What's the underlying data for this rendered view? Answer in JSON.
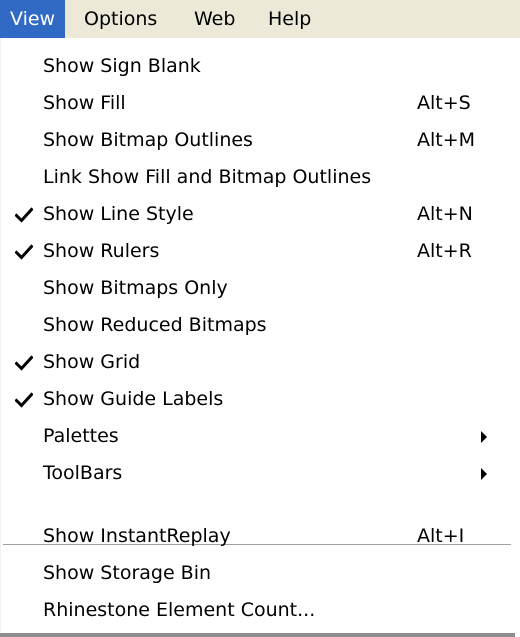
{
  "menubar": {
    "items": [
      {
        "label": "View",
        "active": true
      },
      {
        "label": "Options",
        "active": false
      },
      {
        "label": "Web",
        "active": false
      },
      {
        "label": "Help",
        "active": false
      }
    ]
  },
  "view_menu": {
    "items": [
      {
        "label": "Show Sign Blank",
        "shortcut": "",
        "checked": false,
        "submenu": false
      },
      {
        "label": "Show Fill",
        "shortcut": "Alt+S",
        "checked": false,
        "submenu": false
      },
      {
        "label": "Show Bitmap Outlines",
        "shortcut": "Alt+M",
        "checked": false,
        "submenu": false
      },
      {
        "label": "Link Show Fill and Bitmap Outlines",
        "shortcut": "",
        "checked": false,
        "submenu": false
      },
      {
        "label": "Show Line Style",
        "shortcut": "Alt+N",
        "checked": true,
        "submenu": false
      },
      {
        "label": "Show Rulers",
        "shortcut": "Alt+R",
        "checked": true,
        "submenu": false
      },
      {
        "label": "Show Bitmaps Only",
        "shortcut": "",
        "checked": false,
        "submenu": false
      },
      {
        "label": "Show Reduced Bitmaps",
        "shortcut": "",
        "checked": false,
        "submenu": false
      },
      {
        "label": "Show Grid",
        "shortcut": "",
        "checked": true,
        "submenu": false
      },
      {
        "label": "Show Guide Labels",
        "shortcut": "",
        "checked": true,
        "submenu": false
      },
      {
        "label": "Palettes",
        "shortcut": "",
        "checked": false,
        "submenu": true
      },
      {
        "label": "ToolBars",
        "shortcut": "",
        "checked": false,
        "submenu": true
      },
      {
        "label": "Show InstantReplay",
        "shortcut": "Alt+I",
        "checked": false,
        "submenu": false
      },
      {
        "label": "Show Storage Bin",
        "shortcut": "",
        "checked": false,
        "submenu": false
      },
      {
        "label": "Rhinestone Element Count...",
        "shortcut": "",
        "checked": false,
        "submenu": false
      }
    ]
  },
  "icons": {
    "check": "checkmark-icon",
    "submenu": "submenu-arrow-icon"
  },
  "colors": {
    "highlight": "#316ac5",
    "menubar_bg": "#ece9d8",
    "menu_bg": "#ffffff"
  }
}
